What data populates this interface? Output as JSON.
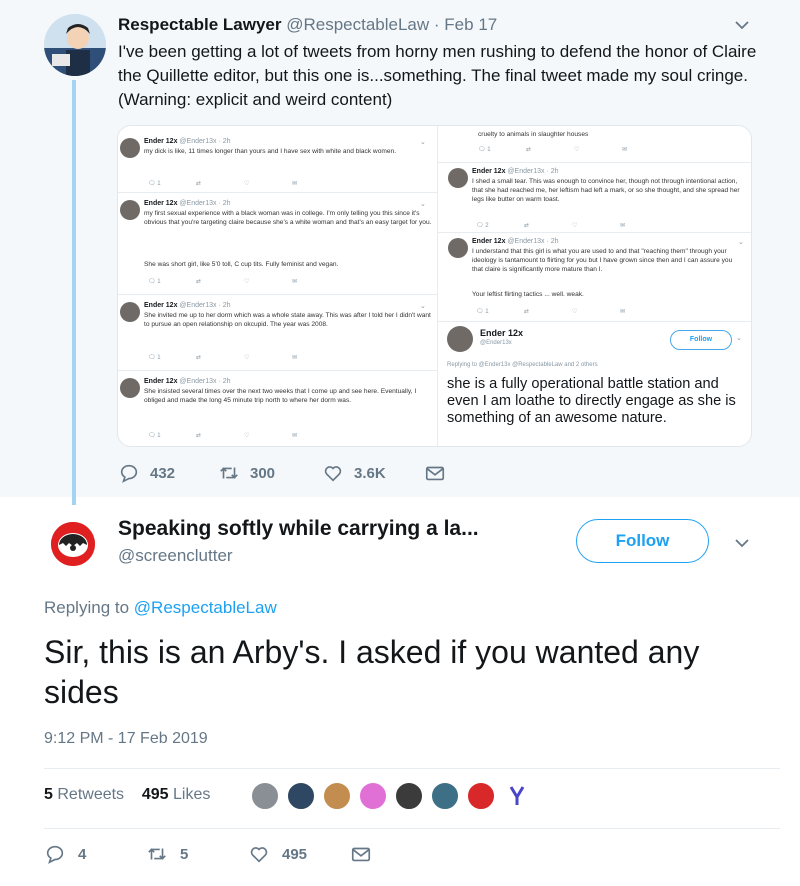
{
  "parent_tweet": {
    "display_name": "Respectable Lawyer",
    "handle": "@RespectableLaw",
    "separator": "·",
    "date": "Feb 17",
    "text": "I've been getting a lot of tweets from horny men rushing to defend the honor of Claire the Quillette editor, but this one is...something. The final tweet made my soul cringe.  (Warning: explicit and weird content)",
    "replies": "432",
    "retweets": "300",
    "likes": "3.6K"
  },
  "embedded": {
    "left": [
      {
        "name": "Ender 12x",
        "meta": "@Ender13x · 2h",
        "text": "my dick is like, 11 times longer than yours and I have sex with white and black women.",
        "counts": [
          "1",
          "",
          "",
          ""
        ]
      },
      {
        "name": "Ender 12x",
        "meta": "@Ender13x · 2h",
        "text": "my first sexual experience with a black woman was in college. I'm only telling you this since it's obvious that you're targeting claire because she's a white woman and that's an easy target for you.",
        "text2": "She was short girl, like 5'0 toll, C cup tits. Fully feminist and vegan.",
        "counts": [
          "1",
          "",
          "",
          ""
        ]
      },
      {
        "name": "Ender 12x",
        "meta": "@Ender13x · 2h",
        "text": "She invited me up to her dorm which was a whole state away. This was after I told her I didn't want to pursue an open relationship on okcupid. The year was 2008.",
        "counts": [
          "1",
          "",
          "",
          ""
        ]
      },
      {
        "name": "Ender 12x",
        "meta": "@Ender13x · 2h",
        "text": "She insisted several times over the next two weeks that I come up and see here. Eventually, I obliged and made the long 45 minute trip north to where her dorm was.",
        "counts": [
          "1",
          "",
          "",
          ""
        ]
      }
    ],
    "right_top_fragment": "cruelty to animals in slaughter houses",
    "right": [
      {
        "name": "Ender 12x",
        "meta": "@Ender13x · 2h",
        "text": "I shed a small tear. This was enough to convince her, though not through intentional action, that she had reached me, her leftism had left a mark, or so she thought, and she spread her legs like butter on warm toast.",
        "counts": [
          "2",
          "",
          "",
          ""
        ]
      },
      {
        "name": "Ender 12x",
        "meta": "@Ender13x · 2h",
        "text": "I understand that this girl is what you are used to and that \"reaching them\" through your ideology is tantamount to flirting for you but I have grown since then and I can assure you that claire is significantly more mature than I.",
        "text2": "Your leftist flirting tactics ... well. weak.",
        "counts": [
          "1",
          "",
          "",
          ""
        ]
      }
    ],
    "profile": {
      "name": "Ender 12x",
      "handle": "@Ender13x",
      "follow_label": "Follow",
      "replying": "Replying to @Ender13x @RespectableLaw and 2 others",
      "big_text": "she is a fully operational battle station and even I am loathe to directly engage as she is something of an awesome nature."
    }
  },
  "reply_tweet": {
    "display_name": "Speaking softly while carrying a la...",
    "handle": "@screenclutter",
    "follow_label": "Follow",
    "replying_prefix": "Replying to",
    "replying_to": "@RespectableLaw",
    "text": "Sir, this is an Arby's. I asked if you wanted any sides",
    "timestamp": "9:12 PM - 17 Feb 2019",
    "retweets_count": "5",
    "retweets_label": "Retweets",
    "likes_count": "495",
    "likes_label": "Likes",
    "replies": "4",
    "retweets": "5",
    "likes": "495"
  },
  "colors": {
    "accent": "#1da1f2",
    "thread_line": "#a5d3f3",
    "muted": "#657786",
    "parent_bg": "#f5f8fa",
    "reply_avatar": "#e02020"
  },
  "icons": [
    "reply-icon",
    "retweet-icon",
    "like-icon",
    "dm-icon",
    "chevron-down-icon"
  ]
}
